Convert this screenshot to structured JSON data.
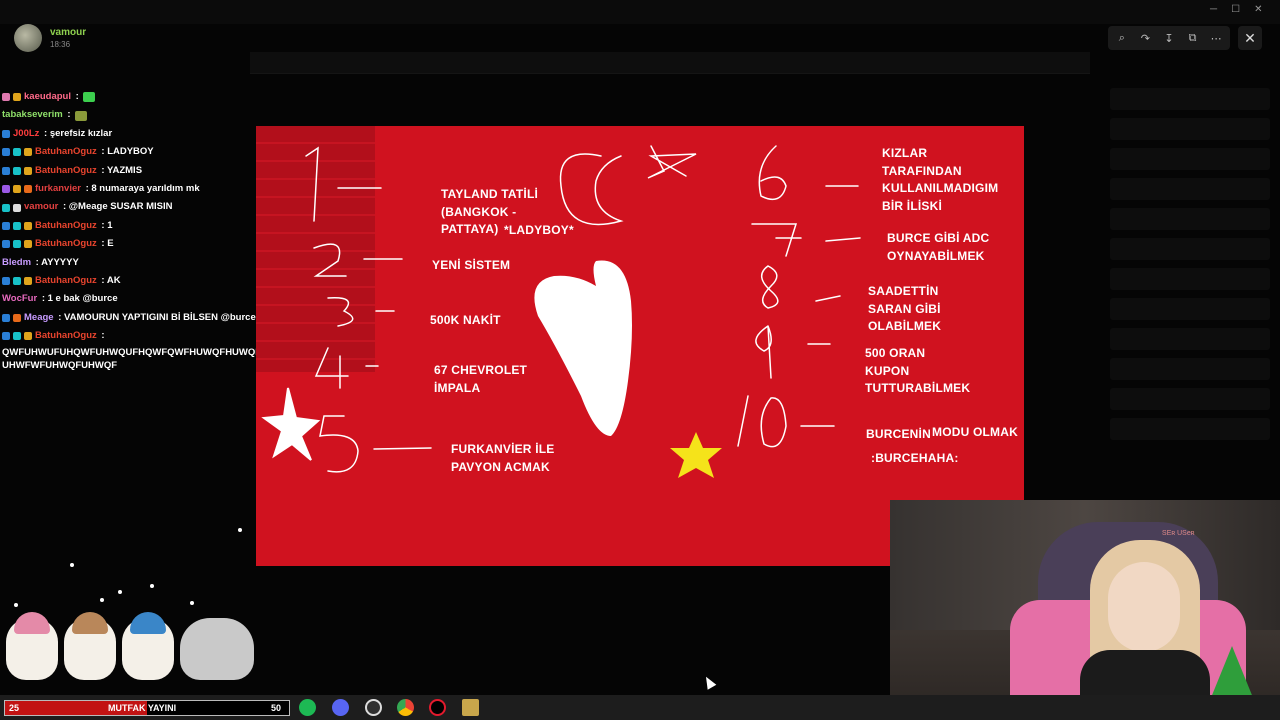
{
  "viewer": {
    "username": "vamour",
    "time": "18:36",
    "tools": [
      "zoom-icon",
      "share-icon",
      "download-icon",
      "open-icon",
      "more-icon"
    ],
    "close_label": "✕"
  },
  "chat": {
    "messages": [
      {
        "user": "kaeudapul",
        "color": "#ff6a8a",
        "badges": [
          "pink",
          "yellow"
        ],
        "text": " : ",
        "emote": "green"
      },
      {
        "user": "tabakseverim",
        "color": "#8fe06a",
        "badges": [],
        "text": " : ",
        "emote": "olive"
      },
      {
        "user": "J00Lz",
        "color": "#ff3d3d",
        "badges": [
          "blue"
        ],
        "text": " : şerefsiz kızlar"
      },
      {
        "user": "BatuhanOguz",
        "color": "#e8442e",
        "badges": [
          "blue",
          "cyan",
          "yellow"
        ],
        "text": " : LADYBOY"
      },
      {
        "user": "BatuhanOguz",
        "color": "#e8442e",
        "badges": [
          "blue",
          "cyan",
          "yellow"
        ],
        "text": " : YAZMIS"
      },
      {
        "user": "furkanvier",
        "color": "#e34040",
        "badges": [
          "purple",
          "yellow",
          "orange"
        ],
        "text": " : 8 numaraya yarıldım mk"
      },
      {
        "user": "vamour",
        "color": "#e34040",
        "badges": [
          "cyan",
          "white"
        ],
        "text": " : @Meage SUSAR MISIN"
      },
      {
        "user": "BatuhanOguz",
        "color": "#e8442e",
        "badges": [
          "blue",
          "cyan",
          "yellow"
        ],
        "text": " : 1"
      },
      {
        "user": "BatuhanOguz",
        "color": "#e8442e",
        "badges": [
          "blue",
          "cyan",
          "yellow"
        ],
        "text": " : E"
      },
      {
        "user": "Bledm",
        "color": "#c79bff",
        "badges": [],
        "text": " : AYYYYY"
      },
      {
        "user": "BatuhanOguz",
        "color": "#e8442e",
        "badges": [
          "blue",
          "cyan",
          "yellow"
        ],
        "text": " : AK"
      },
      {
        "user": "WocFur",
        "color": "#e86abf",
        "badges": [],
        "text": " : 1 e bak @burce"
      },
      {
        "user": "Meage",
        "color": "#c79bff",
        "badges": [
          "blue",
          "orange"
        ],
        "text": " : VAMOURUN YAPTIGINI Bİ BİLSEN @burce ,"
      },
      {
        "user": "BatuhanOguz",
        "color": "#e8442e",
        "badges": [
          "blue",
          "cyan",
          "yellow"
        ],
        "text": " :"
      }
    ],
    "long_message": "QWFUHWUFUHQWFUHWQUFHQWFQWFHUWQFHUWQFUHWQFUHWFUHWUWFUHWFWFUHWQFUHWQF"
  },
  "canvas": {
    "labels": [
      {
        "text": "TAYLAND TATİLİ\n(BANGKOK -\nPATTAYA)"
      },
      {
        "text": "*LADYBOY*"
      },
      {
        "text": "YENİ SİSTEM"
      },
      {
        "text": "500K NAKİT"
      },
      {
        "text": "67 CHEVROLET\nİMPALA"
      },
      {
        "text": "FURKANVİER İLE\nPAVYON ACMAK"
      },
      {
        "text": "KIZLAR\nTARAFINDAN\nKULLANILMADIGIM\nBİR İLİSKİ"
      },
      {
        "text": "BURCE GİBİ ADC\nOYNAYABİLMEK"
      },
      {
        "text": "SAADETTİN\nSARAN GİBİ\nOLABİLMEK"
      },
      {
        "text": "500 ORAN\nKUPON\nTUTTURABİLMEK"
      },
      {
        "text": "BURCENİN"
      },
      {
        "text": "MODU OLMAK"
      },
      {
        "text": ":BURCEHAHA:"
      }
    ],
    "colors": {
      "background": "#d0121f",
      "stripe": "#b20f1b",
      "heart": "#ffffff",
      "star_yellow": "#f5e31a"
    }
  },
  "webcam": {
    "mirror_text": "ᴙɘƧU ᴙƎƧ"
  },
  "taskbar": {
    "goal_current": "25",
    "goal_label": "MUTFAK YAYINI",
    "goal_max": "50",
    "goal_progress": 0.5,
    "apps": [
      "spotify-icon",
      "discord-icon",
      "obs-icon",
      "chrome-icon",
      "opera-icon",
      "league-icon"
    ]
  }
}
